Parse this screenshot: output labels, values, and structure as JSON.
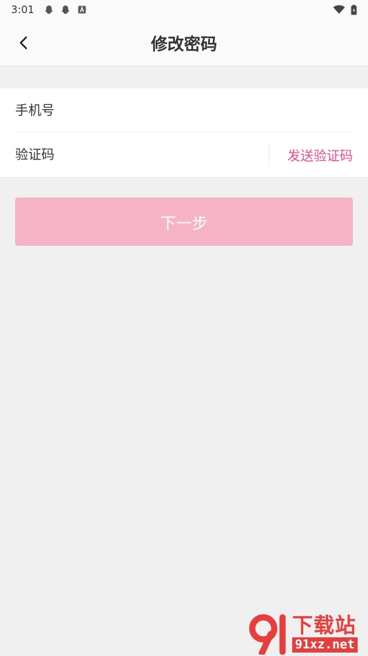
{
  "status_bar": {
    "time": "3:01"
  },
  "header": {
    "title": "修改密码"
  },
  "form": {
    "phone_placeholder": "手机号",
    "phone_value": "",
    "code_placeholder": "验证码",
    "code_value": "",
    "send_code_label": "发送验证码"
  },
  "actions": {
    "next_label": "下一步"
  },
  "watermark": {
    "brand_text": "下载站",
    "url_text": "91xz.net"
  },
  "colors": {
    "accent": "#f04a8c",
    "button_disabled": "#f7b3c6",
    "background": "#f0f0f0"
  }
}
